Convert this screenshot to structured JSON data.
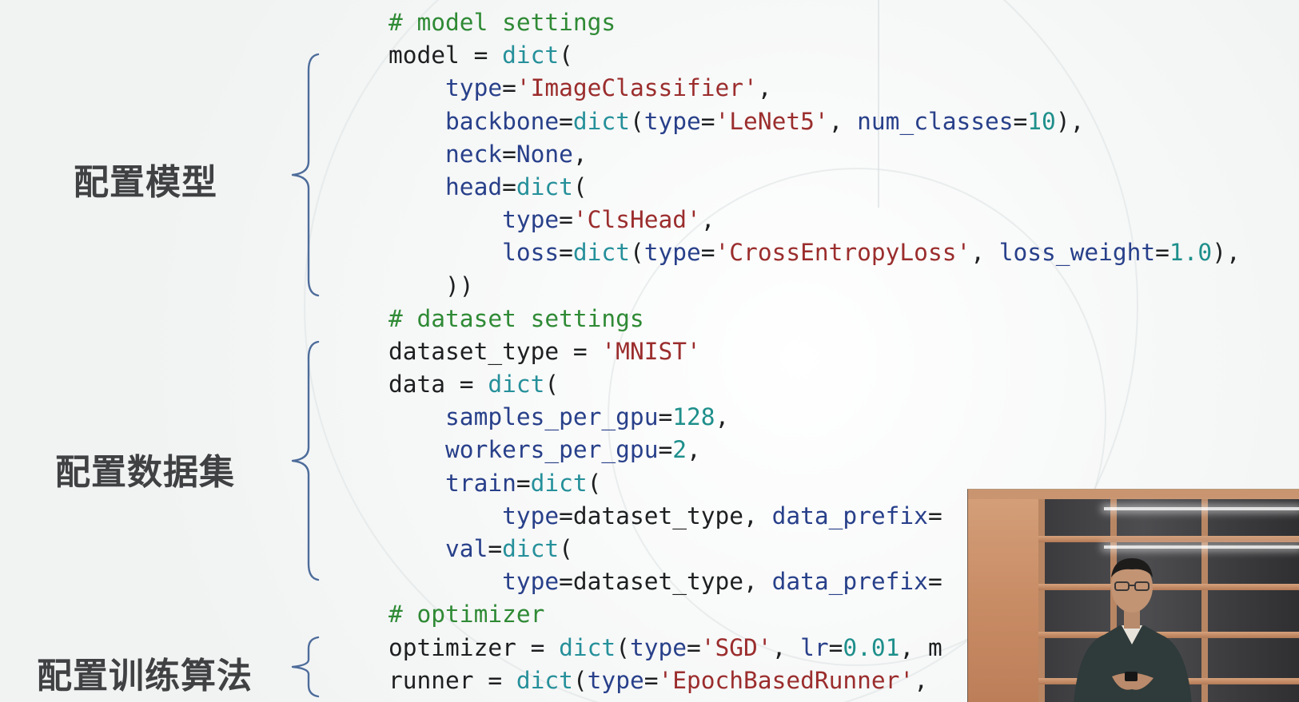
{
  "sections": {
    "model": "配置模型",
    "dataset": "配置数据集",
    "training": "配置训练算法"
  },
  "colors": {
    "background": "#f4f6f6",
    "label_text": "#3f4142",
    "brace": "#4d6c9a",
    "comment": "#2f8a35",
    "text": "#1d1f20",
    "keyword": "#28408a",
    "function": "#25909a",
    "string": "#9b2d2d",
    "number": "#1e8f8b"
  },
  "code": {
    "lines": [
      [
        {
          "c": "comment",
          "t": "# model settings"
        }
      ],
      [
        {
          "c": "text",
          "t": "model = "
        },
        {
          "c": "fn",
          "t": "dict"
        },
        {
          "c": "text",
          "t": "("
        }
      ],
      [
        {
          "c": "text",
          "t": "    "
        },
        {
          "c": "kw",
          "t": "type"
        },
        {
          "c": "text",
          "t": "="
        },
        {
          "c": "str",
          "t": "'ImageClassifier'"
        },
        {
          "c": "text",
          "t": ","
        }
      ],
      [
        {
          "c": "text",
          "t": "    "
        },
        {
          "c": "kw",
          "t": "backbone"
        },
        {
          "c": "text",
          "t": "="
        },
        {
          "c": "fn",
          "t": "dict"
        },
        {
          "c": "text",
          "t": "("
        },
        {
          "c": "kw",
          "t": "type"
        },
        {
          "c": "text",
          "t": "="
        },
        {
          "c": "str",
          "t": "'LeNet5'"
        },
        {
          "c": "text",
          "t": ", "
        },
        {
          "c": "kw",
          "t": "num_classes"
        },
        {
          "c": "text",
          "t": "="
        },
        {
          "c": "num",
          "t": "10"
        },
        {
          "c": "text",
          "t": "),"
        }
      ],
      [
        {
          "c": "text",
          "t": "    "
        },
        {
          "c": "kw",
          "t": "neck"
        },
        {
          "c": "text",
          "t": "="
        },
        {
          "c": "kw",
          "t": "None"
        },
        {
          "c": "text",
          "t": ","
        }
      ],
      [
        {
          "c": "text",
          "t": "    "
        },
        {
          "c": "kw",
          "t": "head"
        },
        {
          "c": "text",
          "t": "="
        },
        {
          "c": "fn",
          "t": "dict"
        },
        {
          "c": "text",
          "t": "("
        }
      ],
      [
        {
          "c": "text",
          "t": "        "
        },
        {
          "c": "kw",
          "t": "type"
        },
        {
          "c": "text",
          "t": "="
        },
        {
          "c": "str",
          "t": "'ClsHead'"
        },
        {
          "c": "text",
          "t": ","
        }
      ],
      [
        {
          "c": "text",
          "t": "        "
        },
        {
          "c": "kw",
          "t": "loss"
        },
        {
          "c": "text",
          "t": "="
        },
        {
          "c": "fn",
          "t": "dict"
        },
        {
          "c": "text",
          "t": "("
        },
        {
          "c": "kw",
          "t": "type"
        },
        {
          "c": "text",
          "t": "="
        },
        {
          "c": "str",
          "t": "'CrossEntropyLoss'"
        },
        {
          "c": "text",
          "t": ", "
        },
        {
          "c": "kw",
          "t": "loss_weight"
        },
        {
          "c": "text",
          "t": "="
        },
        {
          "c": "num",
          "t": "1.0"
        },
        {
          "c": "text",
          "t": "),"
        }
      ],
      [
        {
          "c": "text",
          "t": "    ))"
        }
      ],
      [
        {
          "c": "comment",
          "t": "# dataset settings"
        }
      ],
      [
        {
          "c": "text",
          "t": "dataset_type = "
        },
        {
          "c": "str",
          "t": "'MNIST'"
        }
      ],
      [
        {
          "c": "text",
          "t": "data = "
        },
        {
          "c": "fn",
          "t": "dict"
        },
        {
          "c": "text",
          "t": "("
        }
      ],
      [
        {
          "c": "text",
          "t": "    "
        },
        {
          "c": "kw",
          "t": "samples_per_gpu"
        },
        {
          "c": "text",
          "t": "="
        },
        {
          "c": "num",
          "t": "128"
        },
        {
          "c": "text",
          "t": ","
        }
      ],
      [
        {
          "c": "text",
          "t": "    "
        },
        {
          "c": "kw",
          "t": "workers_per_gpu"
        },
        {
          "c": "text",
          "t": "="
        },
        {
          "c": "num",
          "t": "2"
        },
        {
          "c": "text",
          "t": ","
        }
      ],
      [
        {
          "c": "text",
          "t": "    "
        },
        {
          "c": "kw",
          "t": "train"
        },
        {
          "c": "text",
          "t": "="
        },
        {
          "c": "fn",
          "t": "dict"
        },
        {
          "c": "text",
          "t": "("
        }
      ],
      [
        {
          "c": "text",
          "t": "        "
        },
        {
          "c": "kw",
          "t": "type"
        },
        {
          "c": "text",
          "t": "=dataset_type, "
        },
        {
          "c": "kw",
          "t": "data_prefix"
        },
        {
          "c": "text",
          "t": "="
        }
      ],
      [
        {
          "c": "text",
          "t": "    "
        },
        {
          "c": "kw",
          "t": "val"
        },
        {
          "c": "text",
          "t": "="
        },
        {
          "c": "fn",
          "t": "dict"
        },
        {
          "c": "text",
          "t": "("
        }
      ],
      [
        {
          "c": "text",
          "t": "        "
        },
        {
          "c": "kw",
          "t": "type"
        },
        {
          "c": "text",
          "t": "=dataset_type, "
        },
        {
          "c": "kw",
          "t": "data_prefix"
        },
        {
          "c": "text",
          "t": "="
        }
      ],
      [
        {
          "c": "comment",
          "t": "# optimizer"
        }
      ],
      [
        {
          "c": "text",
          "t": "optimizer = "
        },
        {
          "c": "fn",
          "t": "dict"
        },
        {
          "c": "text",
          "t": "("
        },
        {
          "c": "kw",
          "t": "type"
        },
        {
          "c": "text",
          "t": "="
        },
        {
          "c": "str",
          "t": "'SGD'"
        },
        {
          "c": "text",
          "t": ", "
        },
        {
          "c": "kw",
          "t": "lr"
        },
        {
          "c": "text",
          "t": "="
        },
        {
          "c": "num",
          "t": "0.01"
        },
        {
          "c": "text",
          "t": ", m"
        }
      ],
      [
        {
          "c": "text",
          "t": "runner = "
        },
        {
          "c": "fn",
          "t": "dict"
        },
        {
          "c": "text",
          "t": "("
        },
        {
          "c": "kw",
          "t": "type"
        },
        {
          "c": "text",
          "t": "="
        },
        {
          "c": "str",
          "t": "'EpochBasedRunner'"
        },
        {
          "c": "text",
          "t": ","
        }
      ]
    ]
  },
  "video_overlay": {
    "content": "presenter-webcam"
  }
}
